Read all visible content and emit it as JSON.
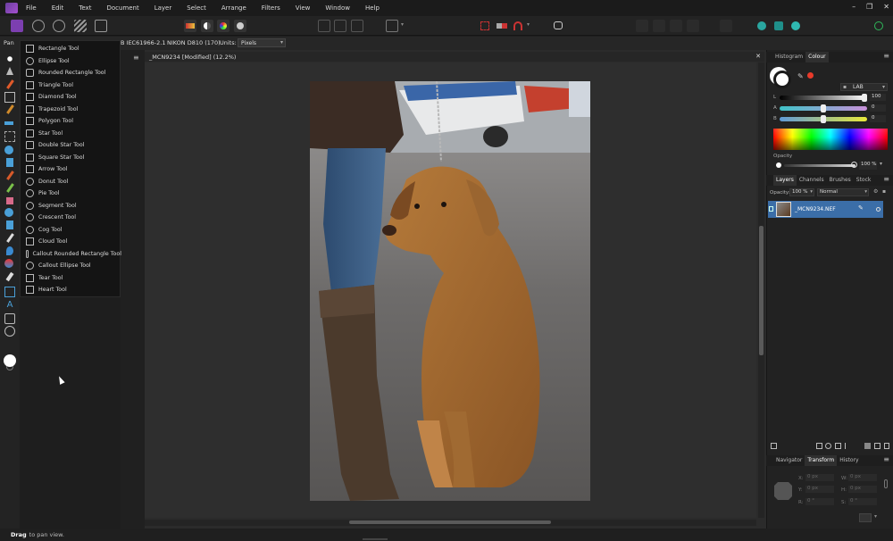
{
  "menubar": {
    "items": [
      "File",
      "Edit",
      "Text",
      "Document",
      "Layer",
      "Select",
      "Arrange",
      "Filters",
      "View",
      "Window",
      "Help"
    ],
    "window_controls": [
      "–",
      "❐",
      "✕"
    ]
  },
  "context": {
    "tool_label": "Pan",
    "color_profile": "B IEC61966-2.1",
    "camera": "NIKON D810 (170)",
    "units_label": "Units:",
    "units_value": "Pixels"
  },
  "flyout": {
    "items": [
      {
        "label": "Rectangle Tool",
        "icon": "rectangle-icon"
      },
      {
        "label": "Ellipse Tool",
        "icon": "ellipse-icon"
      },
      {
        "label": "Rounded Rectangle Tool",
        "icon": "rounded-rectangle-icon"
      },
      {
        "label": "Triangle Tool",
        "icon": "triangle-icon"
      },
      {
        "label": "Diamond Tool",
        "icon": "diamond-icon"
      },
      {
        "label": "Trapezoid Tool",
        "icon": "trapezoid-icon"
      },
      {
        "label": "Polygon Tool",
        "icon": "polygon-icon"
      },
      {
        "label": "Star Tool",
        "icon": "star-icon"
      },
      {
        "label": "Double Star Tool",
        "icon": "double-star-icon"
      },
      {
        "label": "Square Star Tool",
        "icon": "square-star-icon"
      },
      {
        "label": "Arrow Tool",
        "icon": "arrow-icon"
      },
      {
        "label": "Donut Tool",
        "icon": "donut-icon"
      },
      {
        "label": "Pie Tool",
        "icon": "pie-icon"
      },
      {
        "label": "Segment Tool",
        "icon": "segment-icon"
      },
      {
        "label": "Crescent Tool",
        "icon": "crescent-icon"
      },
      {
        "label": "Cog Tool",
        "icon": "cog-icon"
      },
      {
        "label": "Cloud Tool",
        "icon": "cloud-icon"
      },
      {
        "label": "Callout Rounded Rectangle Tool",
        "icon": "callout-rounded-rectangle-icon"
      },
      {
        "label": "Callout Ellipse Tool",
        "icon": "callout-ellipse-icon"
      },
      {
        "label": "Tear Tool",
        "icon": "tear-icon"
      },
      {
        "label": "Heart Tool",
        "icon": "heart-icon"
      }
    ]
  },
  "document": {
    "tab_title": "_MCN9234 [Modified] (12.2%)",
    "close_glyph": "✕"
  },
  "colour_panel": {
    "tabs": [
      "Histogram",
      "Colour"
    ],
    "active_tab": "Colour",
    "model": "LAB",
    "sliders": [
      {
        "label": "L",
        "value": "100"
      },
      {
        "label": "A",
        "value": "0"
      },
      {
        "label": "B",
        "value": "0"
      }
    ],
    "opacity_label": "Opacity",
    "opacity_value": "100 %"
  },
  "layers_panel": {
    "tabs": [
      "Layers",
      "Channels",
      "Brushes",
      "Stock"
    ],
    "active_tab": "Layers",
    "opacity_label": "Opacity:",
    "opacity_value": "100 %",
    "blend_mode": "Normal",
    "layer_name": "_MCN9234.NEF"
  },
  "transform_panel": {
    "tabs": [
      "Navigator",
      "Transform",
      "History"
    ],
    "active_tab": "Transform",
    "fields": [
      {
        "label": "X:",
        "value": "0 px"
      },
      {
        "label": "W:",
        "value": "0 px"
      },
      {
        "label": "Y:",
        "value": "0 px"
      },
      {
        "label": "H:",
        "value": "0 px"
      },
      {
        "label": "R:",
        "value": "0 °"
      },
      {
        "label": "S:",
        "value": "0 °"
      }
    ]
  },
  "status": {
    "bold": "Drag",
    "text": "to pan view."
  },
  "colors": {
    "accent_blue": "#3b82c4",
    "layer_selected": "#3b6ea8",
    "affinity_purple": "#7c3fb0"
  }
}
